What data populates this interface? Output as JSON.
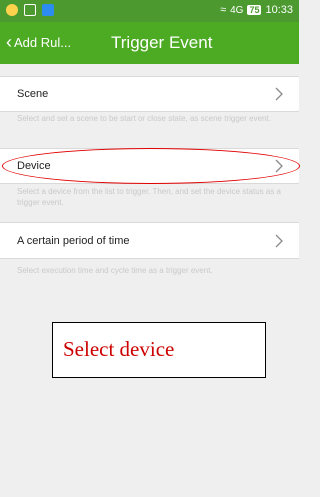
{
  "status_bar": {
    "network": "≈",
    "signal": "4G",
    "battery": "75",
    "time": "10:33"
  },
  "header": {
    "back_label": "Add Rul...",
    "title": "Trigger Event"
  },
  "items": [
    {
      "label": "Scene",
      "description": "Select and set a scene to be start or close state, as scene trigger event."
    },
    {
      "label": "Device",
      "description": "Select a device from the list to trigger. Then, and set the device status as a trigger event."
    },
    {
      "label": "A certain period of time",
      "description": "Select execution time and cycle time as a trigger event."
    }
  ],
  "annotation": {
    "text": "Select device"
  },
  "colors": {
    "header_green": "#4caa23",
    "status_green": "#4c9a2f",
    "highlight_red": "#e00000"
  }
}
